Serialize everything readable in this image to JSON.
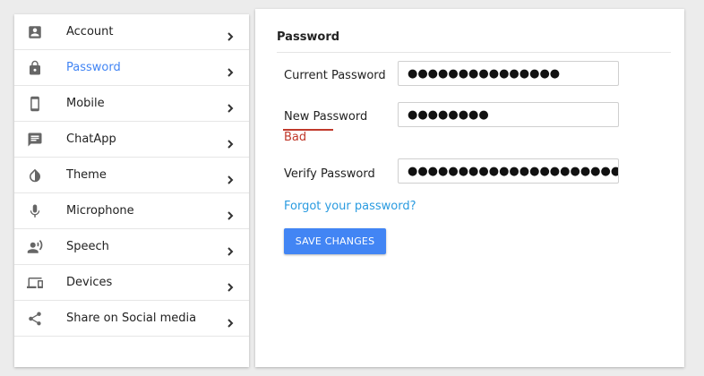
{
  "sidebar": {
    "items": [
      {
        "label": "Account",
        "icon": "account-box-icon"
      },
      {
        "label": "Password",
        "icon": "lock-icon",
        "active": true
      },
      {
        "label": "Mobile",
        "icon": "phone-icon"
      },
      {
        "label": "ChatApp",
        "icon": "chat-icon"
      },
      {
        "label": "Theme",
        "icon": "contrast-drop-icon"
      },
      {
        "label": "Microphone",
        "icon": "microphone-icon"
      },
      {
        "label": "Speech",
        "icon": "record-voice-icon"
      },
      {
        "label": "Devices",
        "icon": "devices-icon"
      },
      {
        "label": "Share on Social media",
        "icon": "share-icon"
      }
    ]
  },
  "main": {
    "title": "Password",
    "current_password": {
      "label": "Current Password",
      "value": "●●●●●●●●●●●●●●●"
    },
    "new_password": {
      "label": "New Password",
      "value": "●●●●●●●●",
      "strength": "Bad"
    },
    "verify_password": {
      "label": "Verify Password",
      "value": "●●●●●●●●●●●●●●●●●●●●●"
    },
    "forgot_link": "Forgot your password?",
    "save_button": "SAVE CHANGES"
  },
  "colors": {
    "accent": "#4285f4",
    "link": "#2a9be0",
    "error": "#c0392b"
  }
}
